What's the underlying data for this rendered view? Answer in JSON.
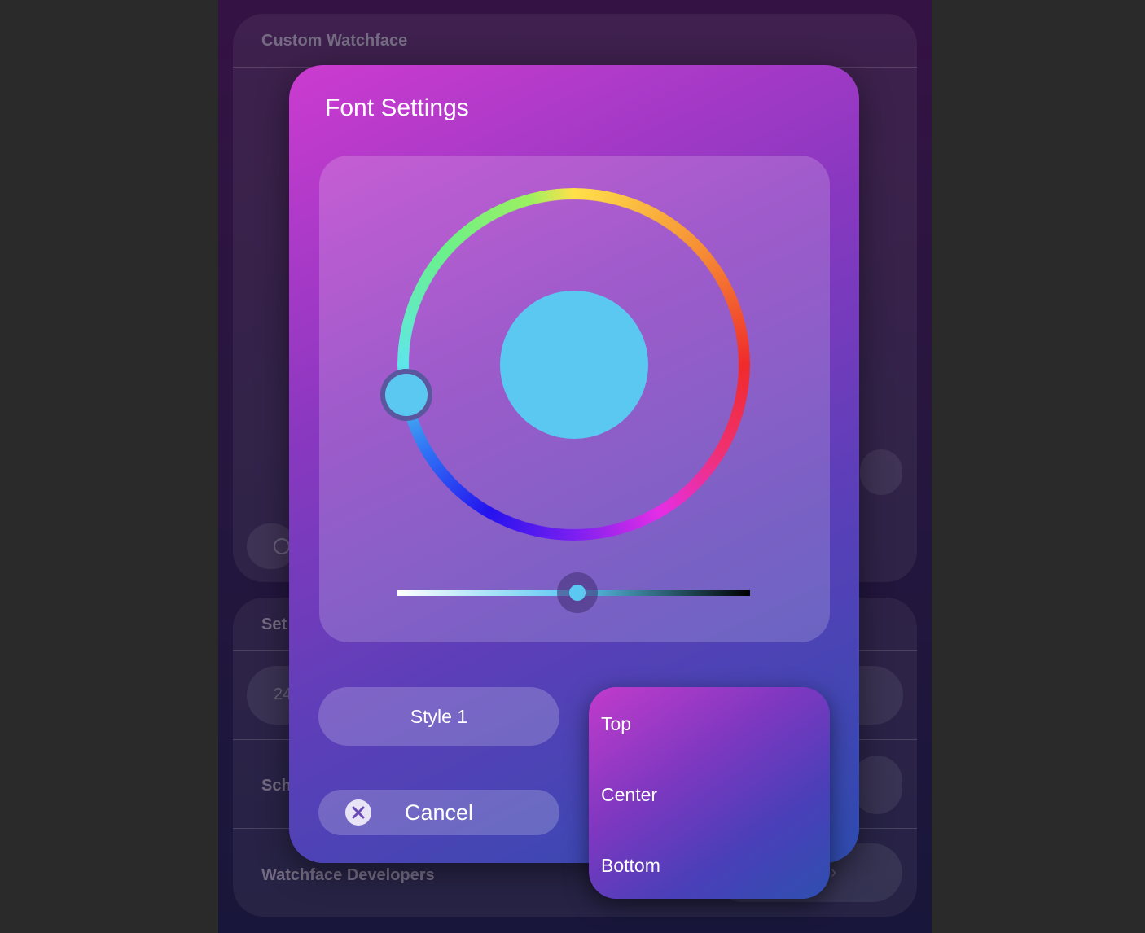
{
  "background": {
    "card1_title": "Custom Watchface",
    "card2_title_partial": "Set",
    "card2_pill_text_partial": "24",
    "schedule_label_partial": "Sch",
    "developers_label": "Watchface Developers"
  },
  "dialog": {
    "title": "Font Settings",
    "selected_color": "#5bc8f2",
    "brightness_level": 0.51,
    "style_button_label": "Style 1",
    "cancel_label": "Cancel"
  },
  "dropdown": {
    "options": [
      "Top",
      "Center",
      "Bottom"
    ]
  },
  "icons": {
    "cancel": "close-circle-icon",
    "chevron": "chevron-right-icon",
    "radio": "circle-icon"
  }
}
